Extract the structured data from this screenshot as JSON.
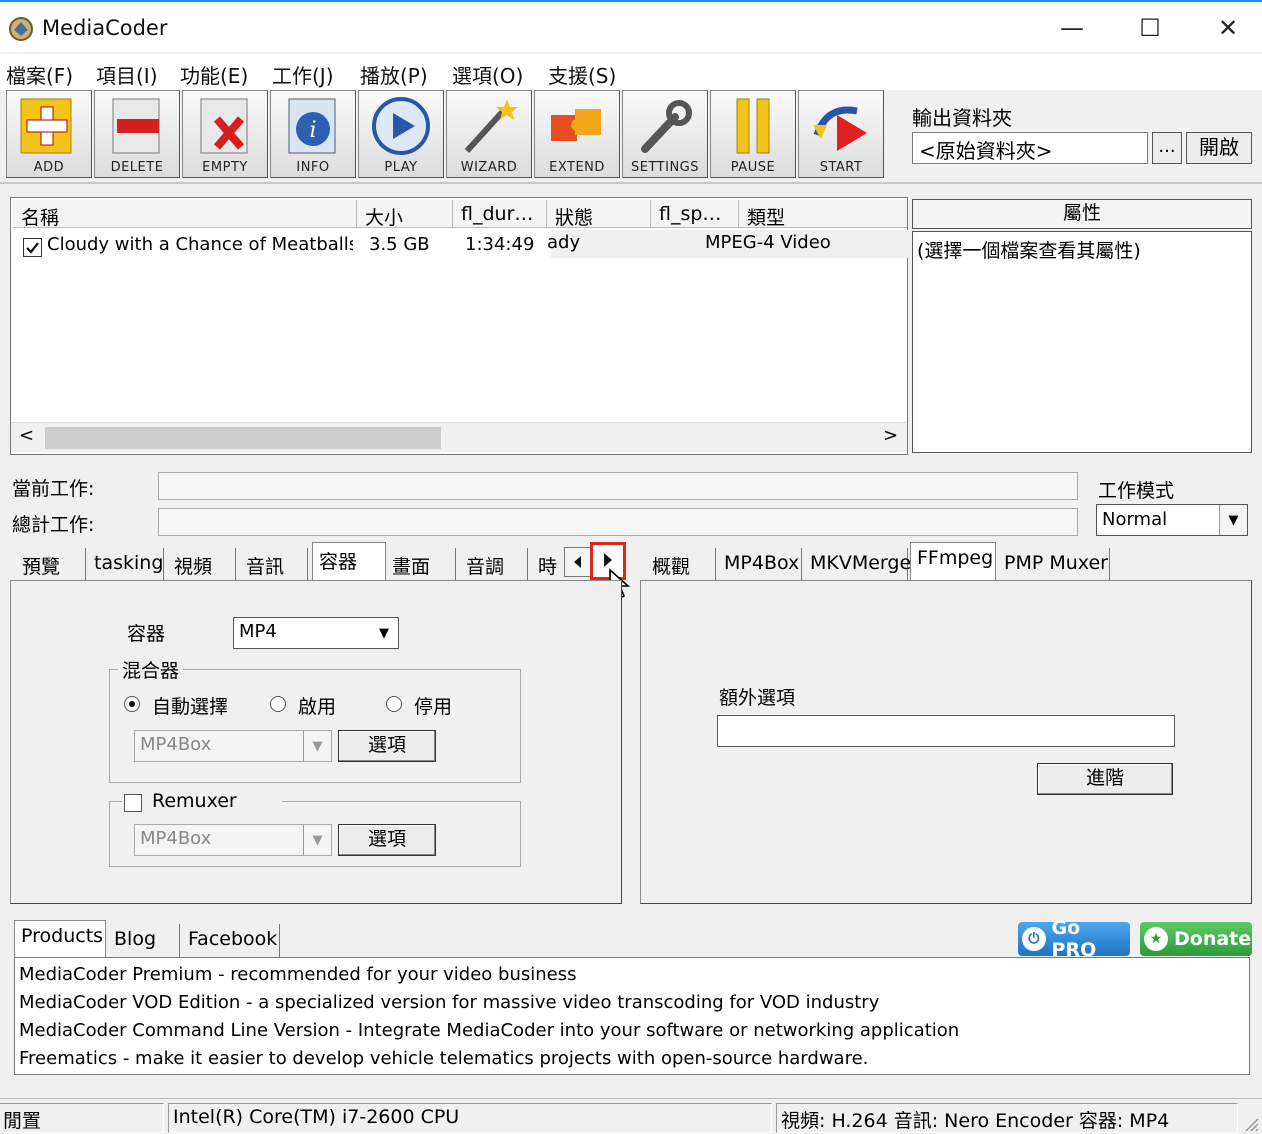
{
  "window": {
    "title": "MediaCoder",
    "minimize": "—",
    "maximize": "☐",
    "close": "✕"
  },
  "menu": [
    "檔案(F)",
    "項目(I)",
    "功能(E)",
    "工作(J)",
    "播放(P)",
    "選項(O)",
    "支援(S)"
  ],
  "toolbar": [
    "ADD",
    "DELETE",
    "EMPTY",
    "INFO",
    "PLAY",
    "WIZARD",
    "EXTEND",
    "SETTINGS",
    "PAUSE",
    "START"
  ],
  "output": {
    "label": "輸出資料夾",
    "value": "<原始資料夾>",
    "browse": "...",
    "open": "開啟"
  },
  "filelist": {
    "columns": [
      "名稱",
      "大小",
      "fl_dur…",
      "狀態",
      "fl_sp…",
      "類型"
    ],
    "rows": [
      {
        "name": "Cloudy with a Chance of Meatballs…",
        "size": "3.5 GB",
        "duration": "1:34:49",
        "status": "ady",
        "speed": "",
        "type": "MPEG-4 Video",
        "checked": true
      }
    ]
  },
  "properties": {
    "header": "屬性",
    "placeholder": "(選擇一個檔案查看其屬性)"
  },
  "progress": {
    "current_label": "當前工作:",
    "total_label": "總計工作:"
  },
  "mode": {
    "label": "工作模式",
    "value": "Normal"
  },
  "left_tabs": [
    "預覽",
    "tasking",
    "視頻",
    "音訊",
    "容器",
    "畫面",
    "音調",
    "時"
  ],
  "left_active": "容器",
  "container": {
    "label": "容器",
    "value": "MP4",
    "muxer": {
      "title": "混合器",
      "options": [
        "自動選擇",
        "啟用",
        "停用"
      ],
      "selected": "自動選擇",
      "value": "MP4Box",
      "button": "選項"
    },
    "remuxer": {
      "title": "Remuxer",
      "value": "MP4Box",
      "button": "選項",
      "checked": false
    }
  },
  "right_tabs": [
    "概觀",
    "MP4Box",
    "MKVMerge",
    "FFmpeg",
    "PMP Muxer"
  ],
  "right_active": "FFmpeg",
  "ffmpeg": {
    "extra_label": "額外選項",
    "extra_value": "",
    "advanced": "進階"
  },
  "bottom_tabs": [
    "Products",
    "Blog",
    "Facebook"
  ],
  "bottom_active": "Products",
  "promos": {
    "gopro": "Go PRO",
    "donate": "Donate"
  },
  "products": [
    "MediaCoder Premium - recommended for your video business",
    "MediaCoder VOD Edition - a specialized version for massive video transcoding for VOD industry",
    "MediaCoder Command Line Version - Integrate MediaCoder into your software or networking application",
    "Freematics - make it easier to develop vehicle telematics projects with open-source hardware."
  ],
  "status": {
    "state": "閒置",
    "cpu": "Intel(R) Core(TM) i7-2600 CPU",
    "summary": "視頻: H.264  音訊: Nero Encoder  容器: MP4"
  },
  "colors": {
    "accent": "#1e90ff",
    "highlight": "#e3251c",
    "gopro": "#2a8fd8",
    "donate": "#3aa84a"
  }
}
